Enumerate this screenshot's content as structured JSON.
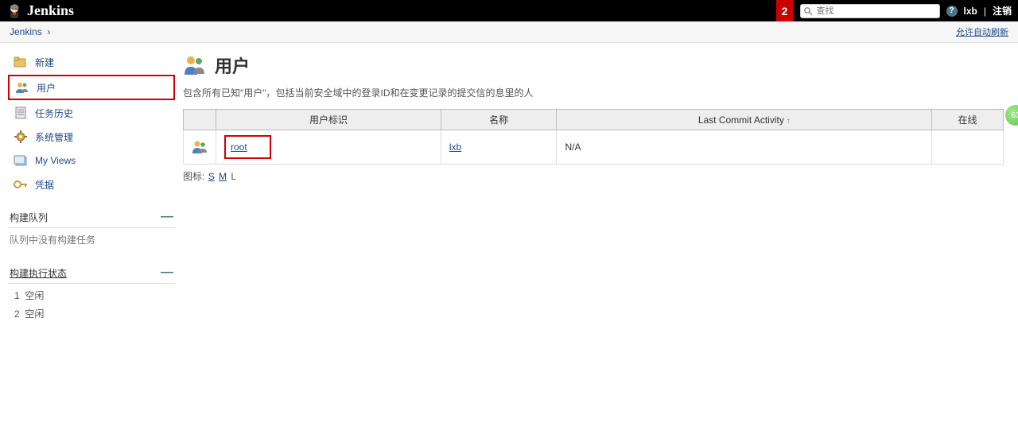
{
  "header": {
    "logo_text": "Jenkins",
    "notif_count": "2",
    "search_placeholder": "查找",
    "user": "lxb",
    "logout": "注销"
  },
  "breadcrumb": {
    "items": [
      "Jenkins"
    ],
    "refresh": "允许自动刷新"
  },
  "sidebar": {
    "links": [
      {
        "label": "新建"
      },
      {
        "label": "用户"
      },
      {
        "label": "任务历史"
      },
      {
        "label": "系统管理"
      },
      {
        "label": "My Views"
      },
      {
        "label": "凭据"
      }
    ],
    "build_queue": {
      "title": "构建队列",
      "empty": "队列中没有构建任务"
    },
    "executor_status": {
      "title": "构建执行状态",
      "executors": [
        {
          "num": "1",
          "state": "空闲"
        },
        {
          "num": "2",
          "state": "空闲"
        }
      ]
    }
  },
  "main": {
    "title": "用户",
    "desc": "包含所有已知\"用户\"，包括当前安全域中的登录ID和在变更记录的提交信的息里的人",
    "table": {
      "headers": {
        "user_id": "用户标识",
        "name": "名称",
        "last_commit": "Last Commit Activity",
        "online": "在线"
      },
      "rows": [
        {
          "user_id": "root",
          "name": "lxb",
          "last_commit": "N/A",
          "online": ""
        }
      ]
    },
    "icon_size": {
      "label": "图标:",
      "s": "S",
      "m": "M",
      "l": "L"
    }
  },
  "float_badge": "63"
}
